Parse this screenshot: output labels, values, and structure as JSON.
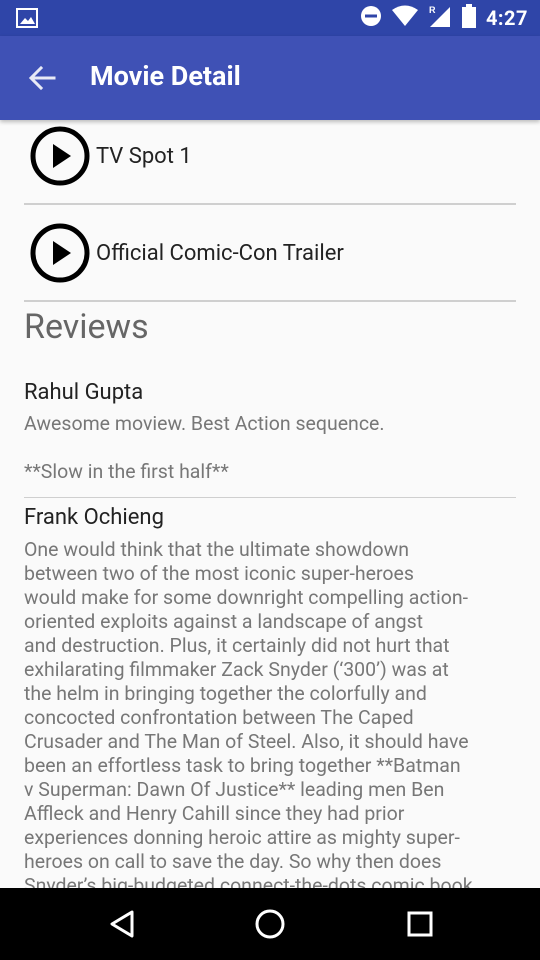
{
  "status_bar": {
    "time": "4:27",
    "icons": [
      "image-icon",
      "do-not-disturb-icon",
      "wifi-icon",
      "signal-roaming-icon",
      "battery-icon"
    ]
  },
  "app_bar": {
    "title": "Movie Detail",
    "back_icon": "arrow-back-icon"
  },
  "trailers": [
    {
      "label": "TV Spot 1",
      "icon": "play-icon"
    },
    {
      "label": "Official Comic-Con Trailer",
      "icon": "play-icon"
    }
  ],
  "reviews": {
    "title": "Reviews",
    "items": [
      {
        "author": "Rahul Gupta",
        "content": "Awesome moview. Best Action sequence.\n\n**Slow in the first half**"
      },
      {
        "author": "Frank Ochieng",
        "content": "One would think that the ultimate showdown\nbetween two of the most iconic super-heroes\nwould make for some downright compelling action-\noriented exploits against a landscape of angst\nand destruction. Plus, it certainly did not hurt that\nexhilarating filmmaker Zack Snyder (‘300’) was at\nthe helm in bringing together the colorfully and\nconcocted confrontation between The Caped\nCrusader and The Man of Steel. Also, it should have\nbeen an effortless task to bring together **Batman\nv Superman: Dawn Of Justice** leading men Ben\nAffleck and Henry Cahill since they had prior\nexperiences donning heroic attire as mighty super-\nheroes on call to save the day. So why then does\nSnyder’s big-budgeted connect-the-dots comic book"
      }
    ]
  },
  "nav_bar": {
    "buttons": [
      "back-triangle-icon",
      "home-circle-icon",
      "recents-square-icon"
    ]
  },
  "colors": {
    "app_bar": "#3f51b5",
    "status_bar": "#2f45a8",
    "background": "#fafafa"
  }
}
